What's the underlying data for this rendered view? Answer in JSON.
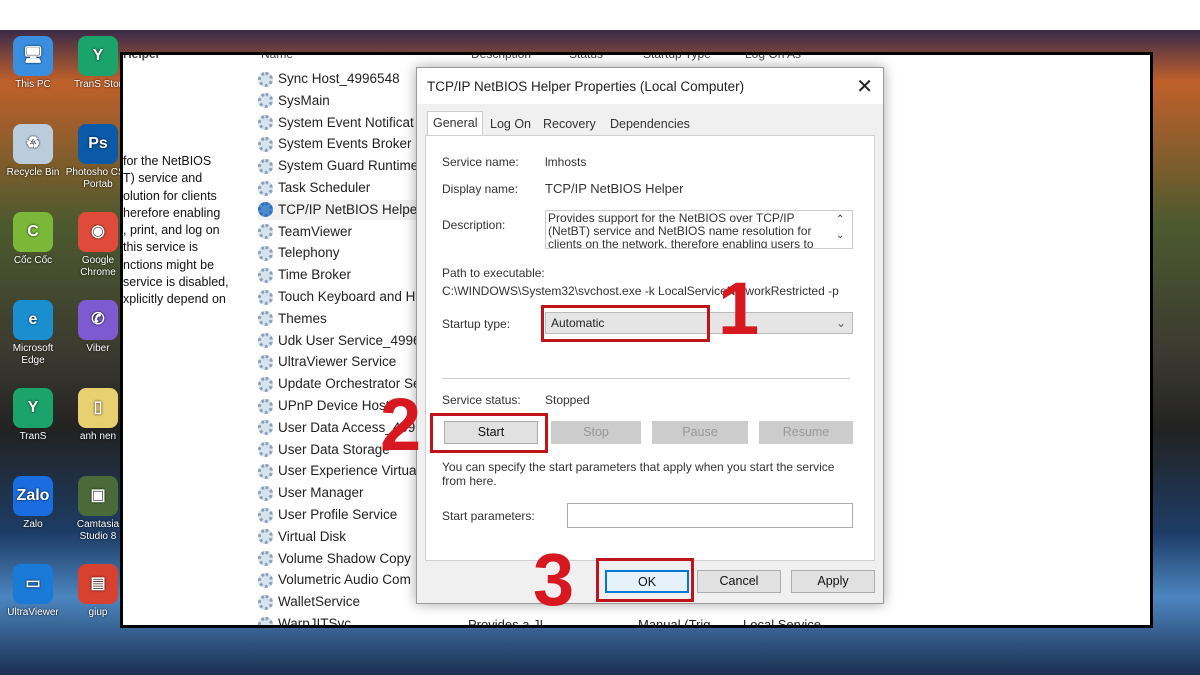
{
  "desktop_icons": [
    {
      "label": "This PC",
      "color": "#3a8ee0",
      "glyph": "🖥"
    },
    {
      "label": "TranS Stor",
      "color": "#1aa36a",
      "glyph": "Y"
    },
    {
      "label": "Recycle Bin",
      "color": "#bcd",
      "glyph": "♻"
    },
    {
      "label": "Photosho CS5 Portab",
      "color": "#0a5aa8",
      "glyph": "Ps"
    },
    {
      "label": "Cốc Cốc",
      "color": "#7bb83a",
      "glyph": "C"
    },
    {
      "label": "Google Chrome",
      "color": "#e04a3a",
      "glyph": "◉"
    },
    {
      "label": "Microsoft Edge",
      "color": "#1a8fd0",
      "glyph": "e"
    },
    {
      "label": "Viber",
      "color": "#7d5ad0",
      "glyph": "✆"
    },
    {
      "label": "TranS",
      "color": "#1aa36a",
      "glyph": "Y"
    },
    {
      "label": "anh nen",
      "color": "#e8cf70",
      "glyph": "▯"
    },
    {
      "label": "Zalo",
      "color": "#1a6de0",
      "glyph": "Zalo"
    },
    {
      "label": "Camtasia Studio 8",
      "color": "#4a6a3a",
      "glyph": "▣"
    },
    {
      "label": "UltraViewer",
      "color": "#1a7ad8",
      "glyph": "▭"
    },
    {
      "label": "giup",
      "color": "#d84030",
      "glyph": "▤"
    }
  ],
  "services_window": {
    "left_title": "Helper",
    "columns": [
      "Name",
      "Description",
      "Status",
      "Startup Type",
      "Log On As"
    ],
    "description_text": [
      "for the NetBIOS",
      "T) service and",
      "olution for clients",
      "herefore enabling",
      ", print, and log on",
      "this service is",
      "nctions might be",
      " service is disabled,",
      "xplicitly depend on"
    ],
    "services": [
      "Sync Host_4996548",
      "SysMain",
      "System Event Notificat",
      "System Events Broker",
      "System Guard Runtime",
      "Task Scheduler",
      "TCP/IP NetBIOS Helper",
      "TeamViewer",
      "Telephony",
      "Time Broker",
      "Touch Keyboard and H",
      "Themes",
      "Udk User Service_49965",
      "UltraViewer Service",
      "Update Orchestrator Se",
      "UPnP Device Host",
      "User Data Access_4996",
      "User Data Storage",
      "User Experience Virtual",
      "User Manager",
      "User Profile Service",
      "Virtual Disk",
      "Volume Shadow Copy",
      "Volumetric Audio Com",
      "WalletService",
      "WarpJITSvc"
    ],
    "selected_service": "TCP/IP NetBIOS Helper",
    "bottom_row": {
      "description": "Provides a JI...",
      "startup": "Manual (Trig...",
      "logon": "Local Service"
    }
  },
  "dialog": {
    "title": "TCP/IP NetBIOS Helper Properties (Local Computer)",
    "tabs": [
      "General",
      "Log On",
      "Recovery",
      "Dependencies"
    ],
    "active_tab": "General",
    "service_name_label": "Service name:",
    "service_name": "lmhosts",
    "display_name_label": "Display name:",
    "display_name": "TCP/IP NetBIOS Helper",
    "description_label": "Description:",
    "description": "Provides support for the NetBIOS over TCP/IP (NetBT) service and NetBIOS name resolution for clients on the network, therefore enabling users to",
    "path_label": "Path to executable:",
    "path": "C:\\WINDOWS\\System32\\svchost.exe -k LocalServiceNetworkRestricted -p",
    "startup_type_label": "Startup type:",
    "startup_type": "Automatic",
    "status_label": "Service status:",
    "status": "Stopped",
    "buttons": {
      "start": "Start",
      "stop": "Stop",
      "pause": "Pause",
      "resume": "Resume",
      "ok": "OK",
      "cancel": "Cancel",
      "apply": "Apply"
    },
    "hint": "You can specify the start parameters that apply when you start the service from here.",
    "params_label": "Start parameters:",
    "params_value": ""
  },
  "annotations": {
    "step1": "1",
    "step2": "2",
    "step3": "3",
    "color": "#d81820"
  }
}
